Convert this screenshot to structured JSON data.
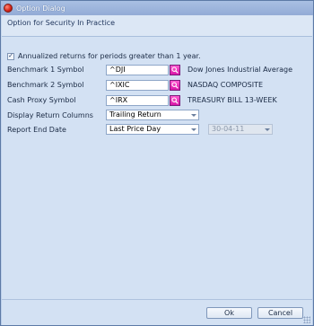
{
  "window": {
    "title": "Option Dialog"
  },
  "header": {
    "text": "Option for Security In Practice"
  },
  "annualized": {
    "checked": true,
    "mark": "✓",
    "label": "Annualized returns for periods greater than 1 year."
  },
  "rows": {
    "benchmark1": {
      "label": "Benchmark 1 Symbol",
      "value": "^DJI",
      "description": "Dow Jones Industrial Average"
    },
    "benchmark2": {
      "label": "Benchmark 2 Symbol",
      "value": "^IXIC",
      "description": "NASDAQ COMPOSITE"
    },
    "cash_proxy": {
      "label": "Cash Proxy Symbol",
      "value": "^IRX",
      "description": "TREASURY BILL 13-WEEK"
    },
    "display_columns": {
      "label": "Display Return Columns",
      "selected": "Trailing Return"
    },
    "report_end_date": {
      "label": "Report End Date",
      "selected": "Last Price Day",
      "date": "30-04-11"
    }
  },
  "buttons": {
    "ok": "Ok",
    "cancel": "Cancel"
  },
  "colors": {
    "lookup_button": "#e022b5",
    "title_bar": "#9fb7df",
    "panel": "#d3e1f3"
  },
  "icons": {
    "app": "app-logo-icon",
    "lookup": "search-icon"
  }
}
